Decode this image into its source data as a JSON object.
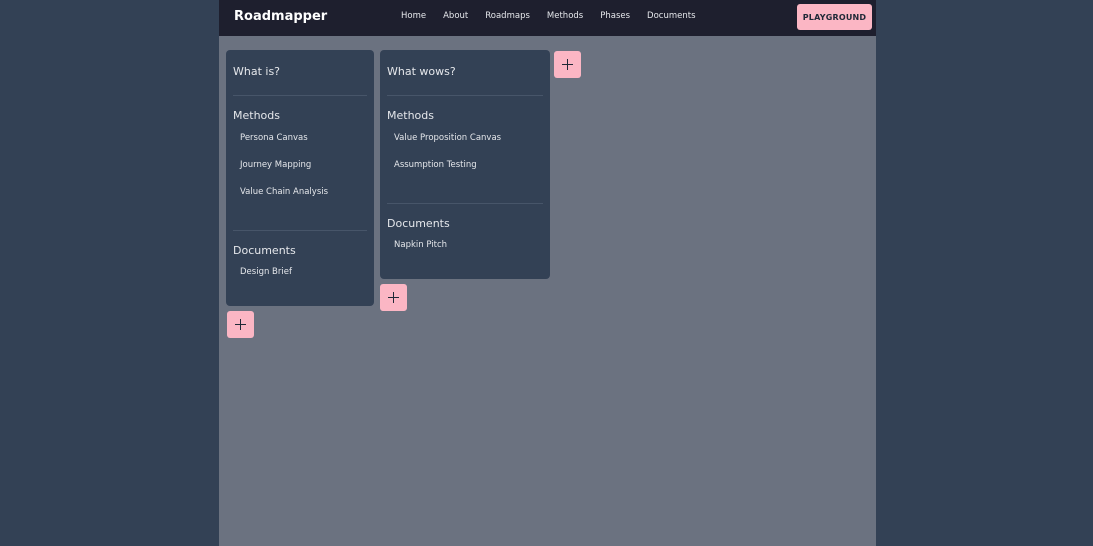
{
  "navbar": {
    "brand": "Roadmapper",
    "links": [
      "Home",
      "About",
      "Roadmaps",
      "Methods",
      "Phases",
      "Documents"
    ],
    "cta_label": "PLAYGROUND"
  },
  "phases": [
    {
      "title": "What is?",
      "methods_heading": "Methods",
      "methods": [
        "Persona Canvas",
        "Journey Mapping",
        "Value Chain Analysis"
      ],
      "documents_heading": "Documents",
      "documents": [
        "Design Brief"
      ]
    },
    {
      "title": "What wows?",
      "methods_heading": "Methods",
      "methods": [
        "Value Proposition Canvas",
        "Assumption Testing"
      ],
      "documents_heading": "Documents",
      "documents": [
        "Napkin Pitch"
      ]
    }
  ],
  "colors": {
    "page_bg": "#334155",
    "canvas_bg": "#6b7280",
    "navbar_bg": "#1e1f2e",
    "card_bg": "#334155",
    "accent_pink": "#fbb6c4"
  }
}
